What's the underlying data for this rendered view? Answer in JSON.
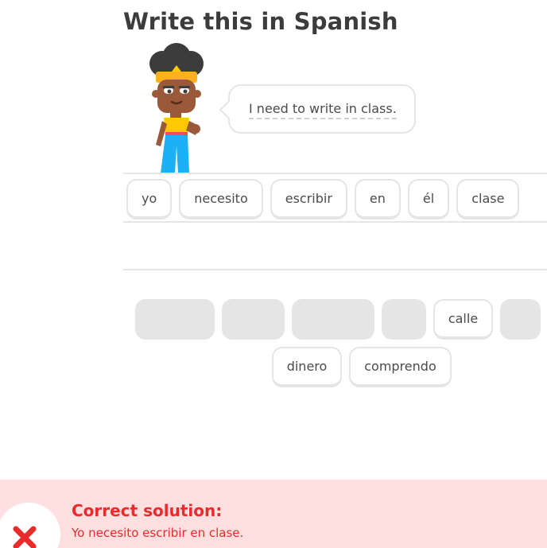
{
  "title": "Write this in Spanish",
  "prompt": {
    "sentence": "I need to write in class."
  },
  "answer_tiles": [
    "yo",
    "necesito",
    "escribir",
    "en",
    "él",
    "clase"
  ],
  "word_bank": {
    "row1_visible_word": "calle",
    "row2": [
      "dinero",
      "comprendo"
    ]
  },
  "feedback": {
    "status": "incorrect",
    "heading": "Correct solution:",
    "solution": "Yo necesito escribir en clase.",
    "color": "#ea2b2b",
    "background": "#ffdfe0",
    "icon": "x-mark-icon"
  },
  "colors": {
    "tile_border": "#e5e5e5",
    "placeholder": "#e5e5e5",
    "text": "#4b4b4b",
    "title": "#3c3c3c"
  }
}
